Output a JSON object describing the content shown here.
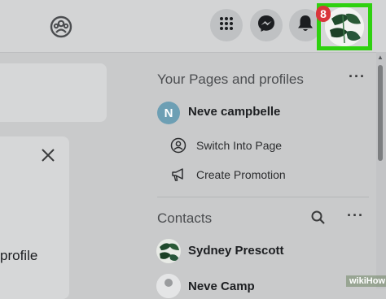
{
  "topbar": {
    "groups_icon": "groups-icon",
    "menu_icon": "grid-menu-icon",
    "messenger_icon": "messenger-icon",
    "notifications_icon": "bell-icon",
    "notification_count": "8",
    "highlight_color": "#2ed10f"
  },
  "left": {
    "profile_text": "profile",
    "close_icon": "close-icon"
  },
  "right_panel": {
    "pages_title": "Your Pages and profiles",
    "page": {
      "initial": "N",
      "name": "Neve campbelle"
    },
    "actions": [
      {
        "icon": "switch-profile-icon",
        "label": "Switch Into Page"
      },
      {
        "icon": "megaphone-icon",
        "label": "Create Promotion"
      }
    ],
    "contacts_title": "Contacts",
    "contacts": [
      {
        "name": "Sydney Prescott"
      },
      {
        "name": "Neve Camp"
      }
    ]
  },
  "watermark": "wikiHow"
}
